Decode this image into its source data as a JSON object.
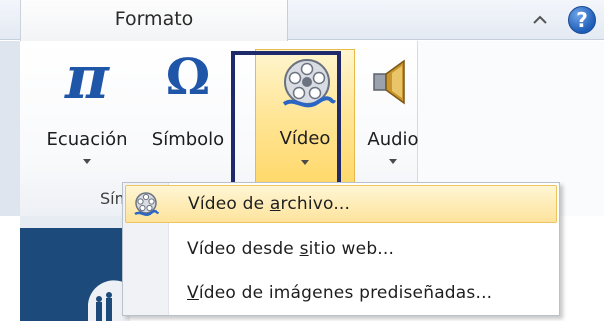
{
  "tab": {
    "label": "Formato"
  },
  "group": {
    "label": "Sím",
    "buttons": [
      {
        "id": "ecuacion",
        "label": "Ecuación",
        "icon": "pi-icon",
        "glyph": "π"
      },
      {
        "id": "simbolo",
        "label": "Símbolo",
        "icon": "omega-icon",
        "glyph": "Ω"
      },
      {
        "id": "video",
        "label": "Vídeo",
        "icon": "film-reel-icon",
        "state": "pressed"
      },
      {
        "id": "audio",
        "label": "Audio",
        "icon": "speaker-icon"
      }
    ]
  },
  "help": {
    "glyph": "?"
  },
  "menu": {
    "items": [
      {
        "pre": "Vídeo de ",
        "accel": "a",
        "post": "rchivo...",
        "state": "hover",
        "icon": "film-reel-icon"
      },
      {
        "pre": "Vídeo desde ",
        "accel": "s",
        "post": "itio web...",
        "icon": ""
      },
      {
        "pre": "",
        "accel": "V",
        "post": "ídeo de imágenes prediseñadas...",
        "icon": ""
      }
    ]
  },
  "colors": {
    "accent_blue": "#1f56a8",
    "hover_gold": "#ffd868",
    "frame_navy": "#1f2a6a"
  }
}
